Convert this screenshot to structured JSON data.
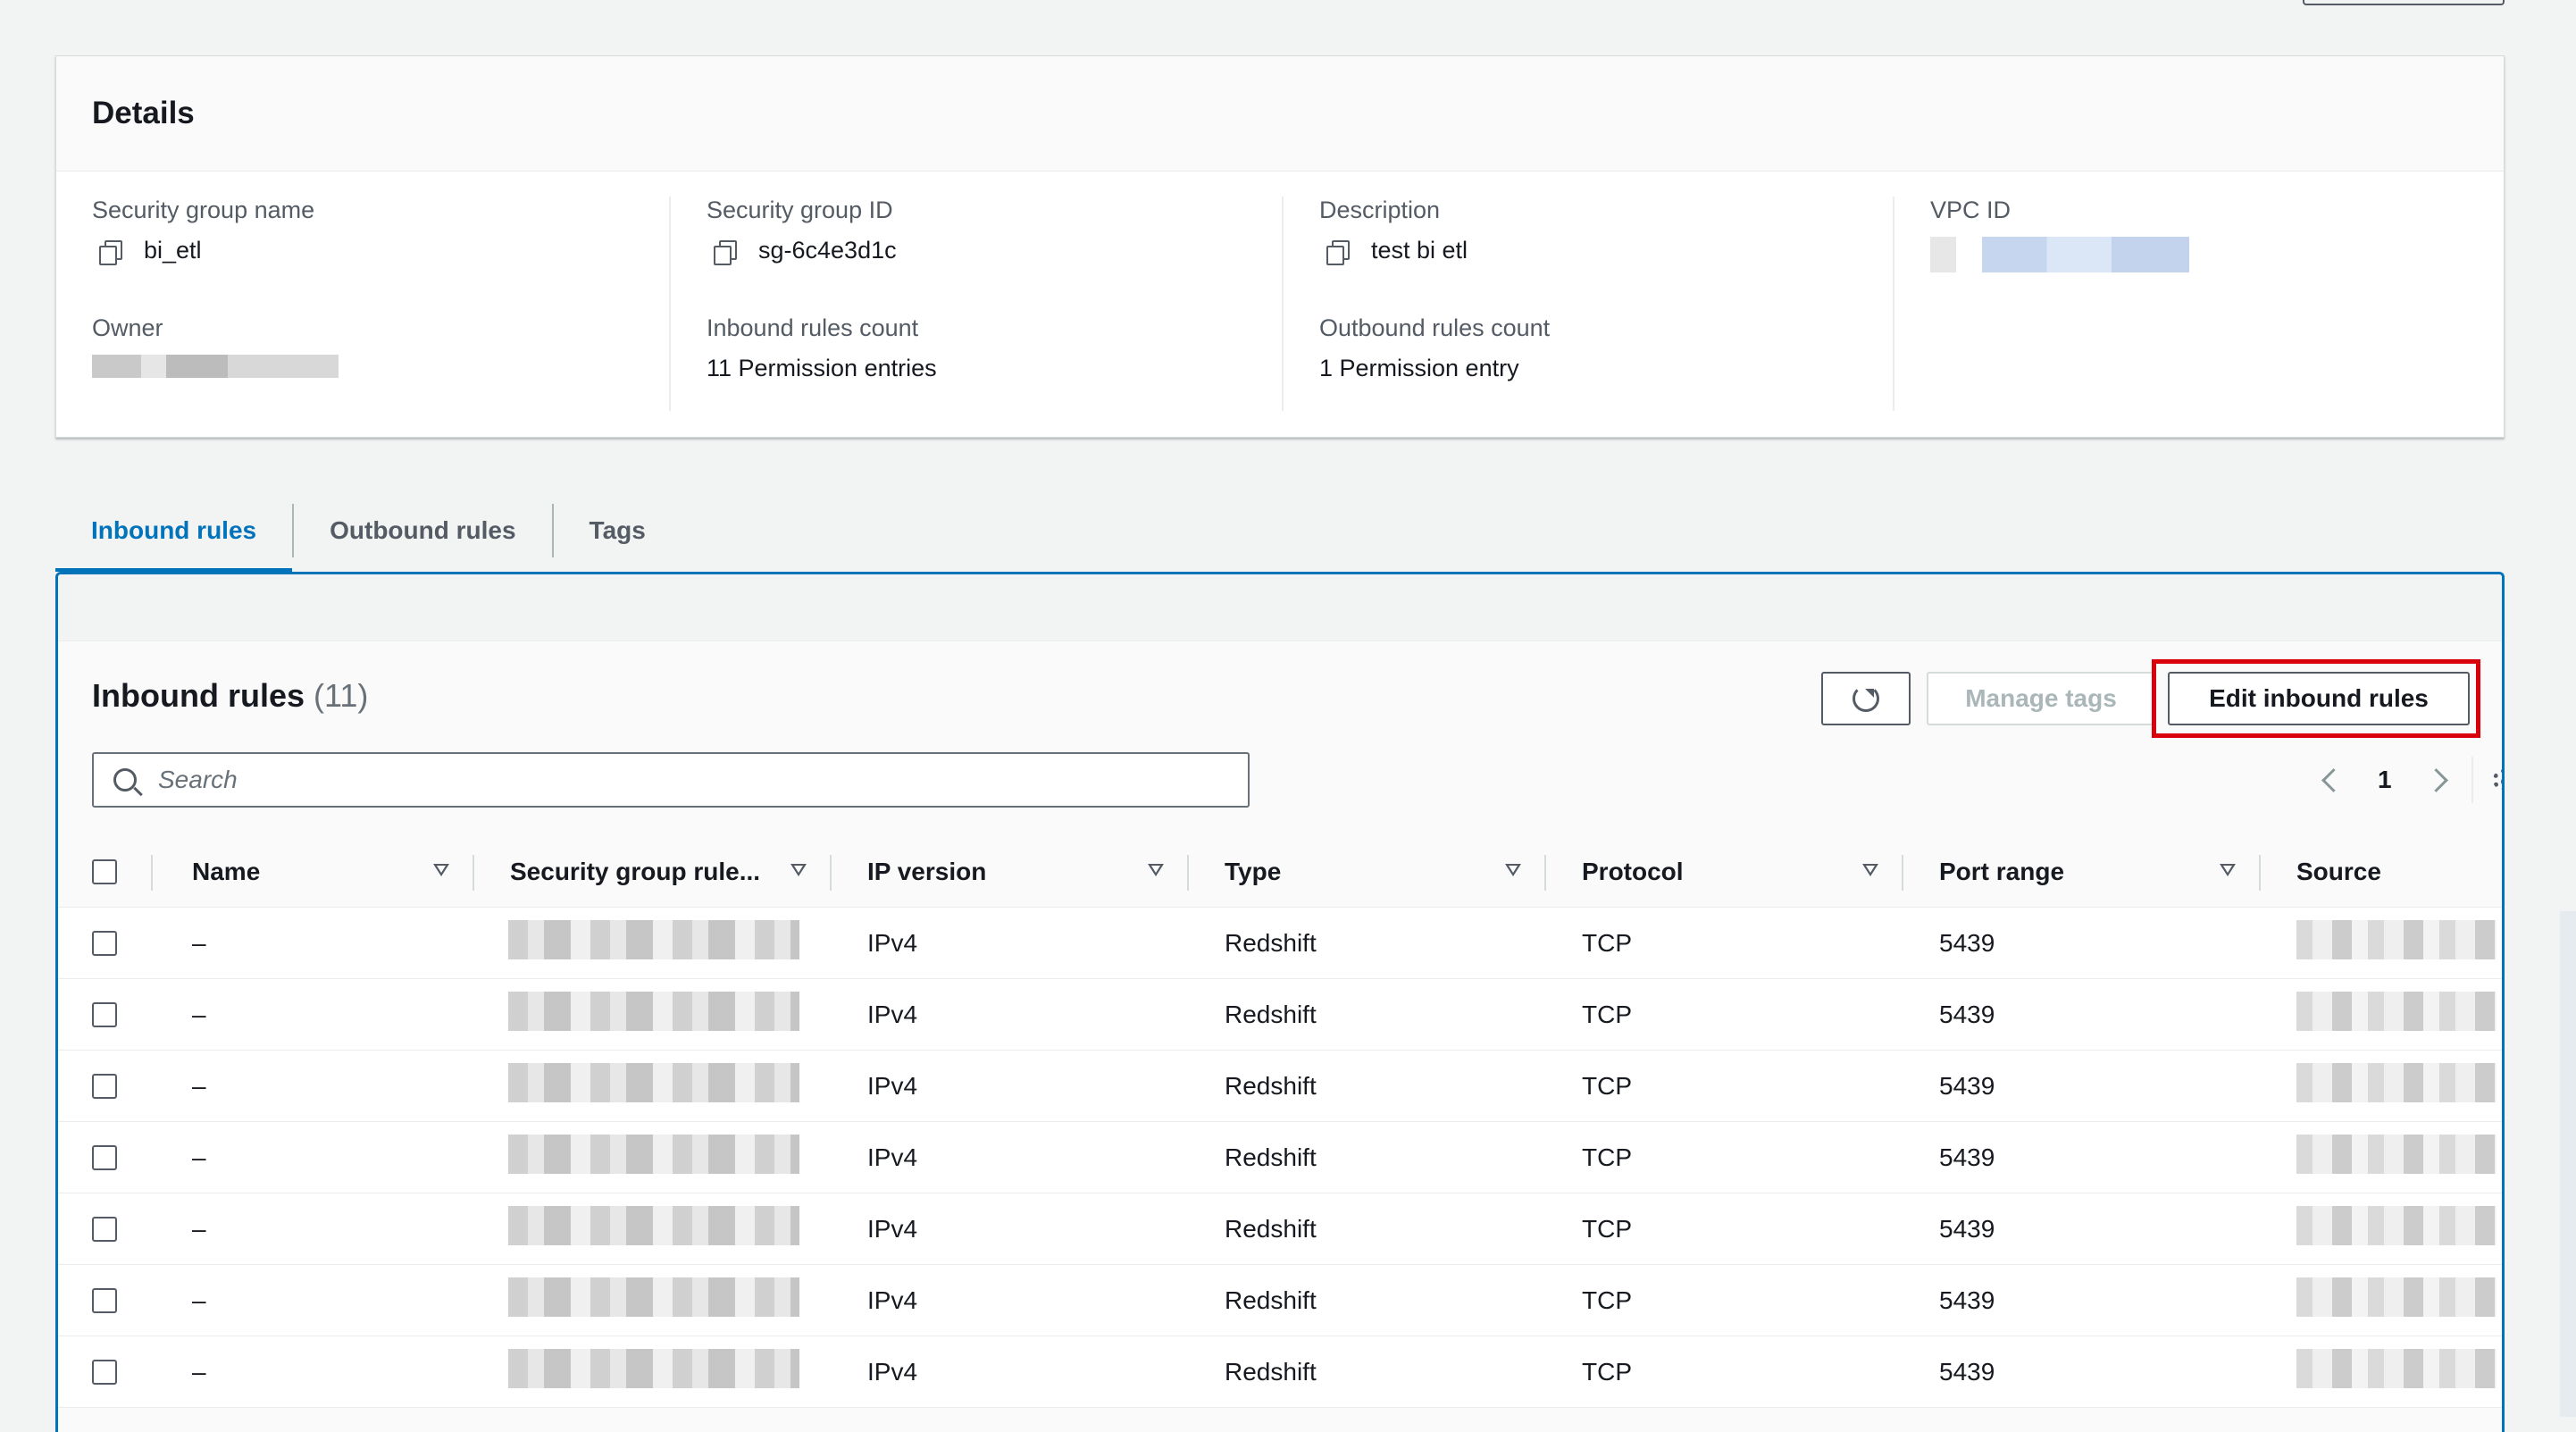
{
  "details": {
    "title": "Details",
    "fields": {
      "sg_name_label": "Security group name",
      "sg_name_value": "bi_etl",
      "sg_id_label": "Security group ID",
      "sg_id_value": "sg-6c4e3d1c",
      "description_label": "Description",
      "description_value": "test bi etl",
      "vpc_label": "VPC ID",
      "owner_label": "Owner",
      "inbound_count_label": "Inbound rules count",
      "inbound_count_value": "11 Permission entries",
      "outbound_count_label": "Outbound rules count",
      "outbound_count_value": "1 Permission entry"
    }
  },
  "tabs": [
    {
      "label": "Inbound rules",
      "active": true
    },
    {
      "label": "Outbound rules",
      "active": false
    },
    {
      "label": "Tags",
      "active": false
    }
  ],
  "rules": {
    "title": "Inbound rules",
    "count": "(11)",
    "manage_tags_label": "Manage tags",
    "edit_label": "Edit inbound rules",
    "search_placeholder": "Search",
    "page": "1",
    "columns": {
      "name": "Name",
      "sg_rule": "Security group rule...",
      "ip_version": "IP version",
      "type": "Type",
      "protocol": "Protocol",
      "port_range": "Port range",
      "source": "Source"
    },
    "rows": [
      {
        "name": "–",
        "ip_version": "IPv4",
        "type": "Redshift",
        "protocol": "TCP",
        "port_range": "5439"
      },
      {
        "name": "–",
        "ip_version": "IPv4",
        "type": "Redshift",
        "protocol": "TCP",
        "port_range": "5439"
      },
      {
        "name": "–",
        "ip_version": "IPv4",
        "type": "Redshift",
        "protocol": "TCP",
        "port_range": "5439"
      },
      {
        "name": "–",
        "ip_version": "IPv4",
        "type": "Redshift",
        "protocol": "TCP",
        "port_range": "5439"
      },
      {
        "name": "–",
        "ip_version": "IPv4",
        "type": "Redshift",
        "protocol": "TCP",
        "port_range": "5439"
      },
      {
        "name": "–",
        "ip_version": "IPv4",
        "type": "Redshift",
        "protocol": "TCP",
        "port_range": "5439"
      },
      {
        "name": "–",
        "ip_version": "IPv4",
        "type": "Redshift",
        "protocol": "TCP",
        "port_range": "5439"
      }
    ]
  },
  "colors": {
    "accent": "#0073bb",
    "highlight": "#d9000b"
  },
  "icons": [
    "copy-icon",
    "refresh-icon",
    "search-icon",
    "chevron-left-icon",
    "chevron-right-icon",
    "gear-icon",
    "sort-icon"
  ]
}
